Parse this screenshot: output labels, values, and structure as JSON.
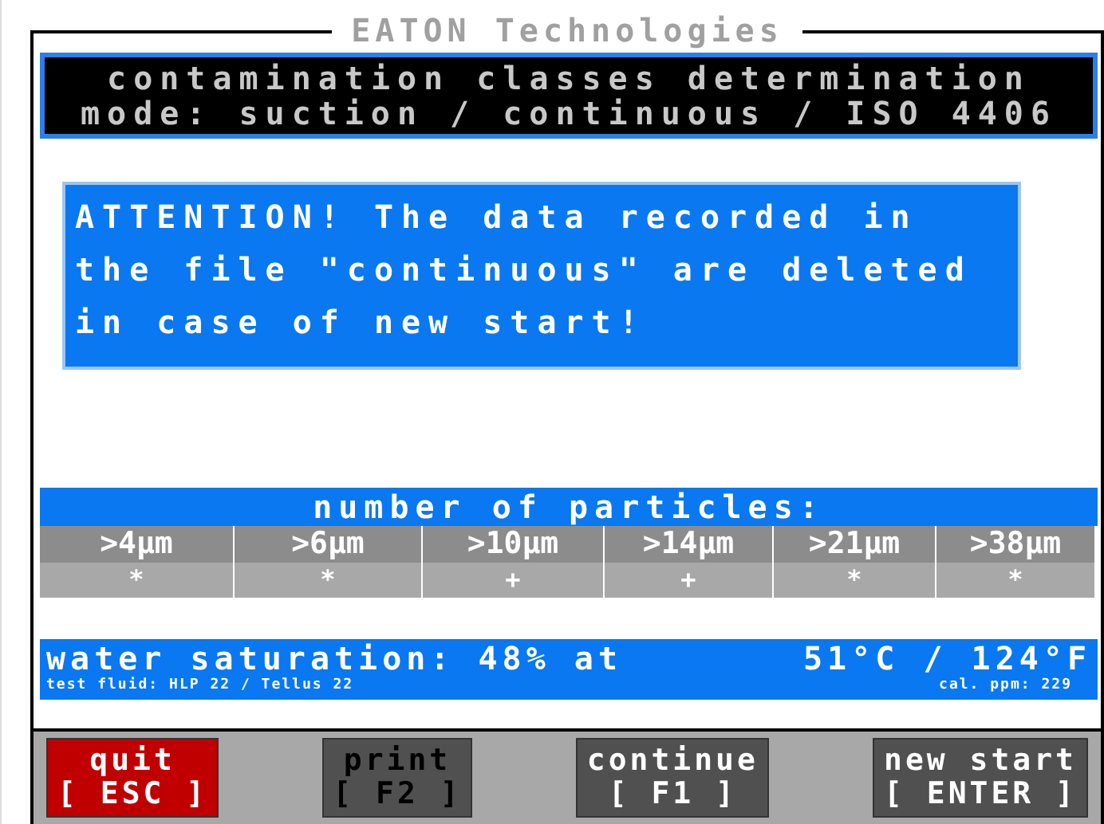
{
  "window": {
    "title": "EATON Technologies"
  },
  "header": {
    "lines": [
      "contamination classes determination",
      "mode: suction / continuous / ISO 4406"
    ]
  },
  "attention": {
    "lines": [
      "ATTENTION! The data recorded in",
      "the file \"continuous\" are deleted",
      "in case of new start!"
    ]
  },
  "particles": {
    "title": "number of particles:",
    "columns": [
      {
        "label": ">4µm",
        "value": "*"
      },
      {
        "label": ">6µm",
        "value": "*"
      },
      {
        "label": ">10µm",
        "value": "+"
      },
      {
        "label": ">14µm",
        "value": "+"
      },
      {
        "label": ">21µm",
        "value": "*"
      },
      {
        "label": ">38µm",
        "value": "*"
      }
    ]
  },
  "water": {
    "saturation": "water saturation: 48% at",
    "temperature": "51°C / 124°F",
    "fluid": "test fluid: HLP 22 / Tellus 22",
    "calibration": "cal. ppm: 229"
  },
  "buttons": [
    {
      "label": "quit",
      "key": "[ ESC ]",
      "selected": true,
      "disabled": false
    },
    {
      "label": "print",
      "key": "[ F2 ]",
      "selected": false,
      "disabled": true
    },
    {
      "label": "continue",
      "key": "[ F1 ]",
      "selected": false,
      "disabled": false
    },
    {
      "label": "new start",
      "key": "[ ENTER ]",
      "selected": false,
      "disabled": false
    }
  ]
}
